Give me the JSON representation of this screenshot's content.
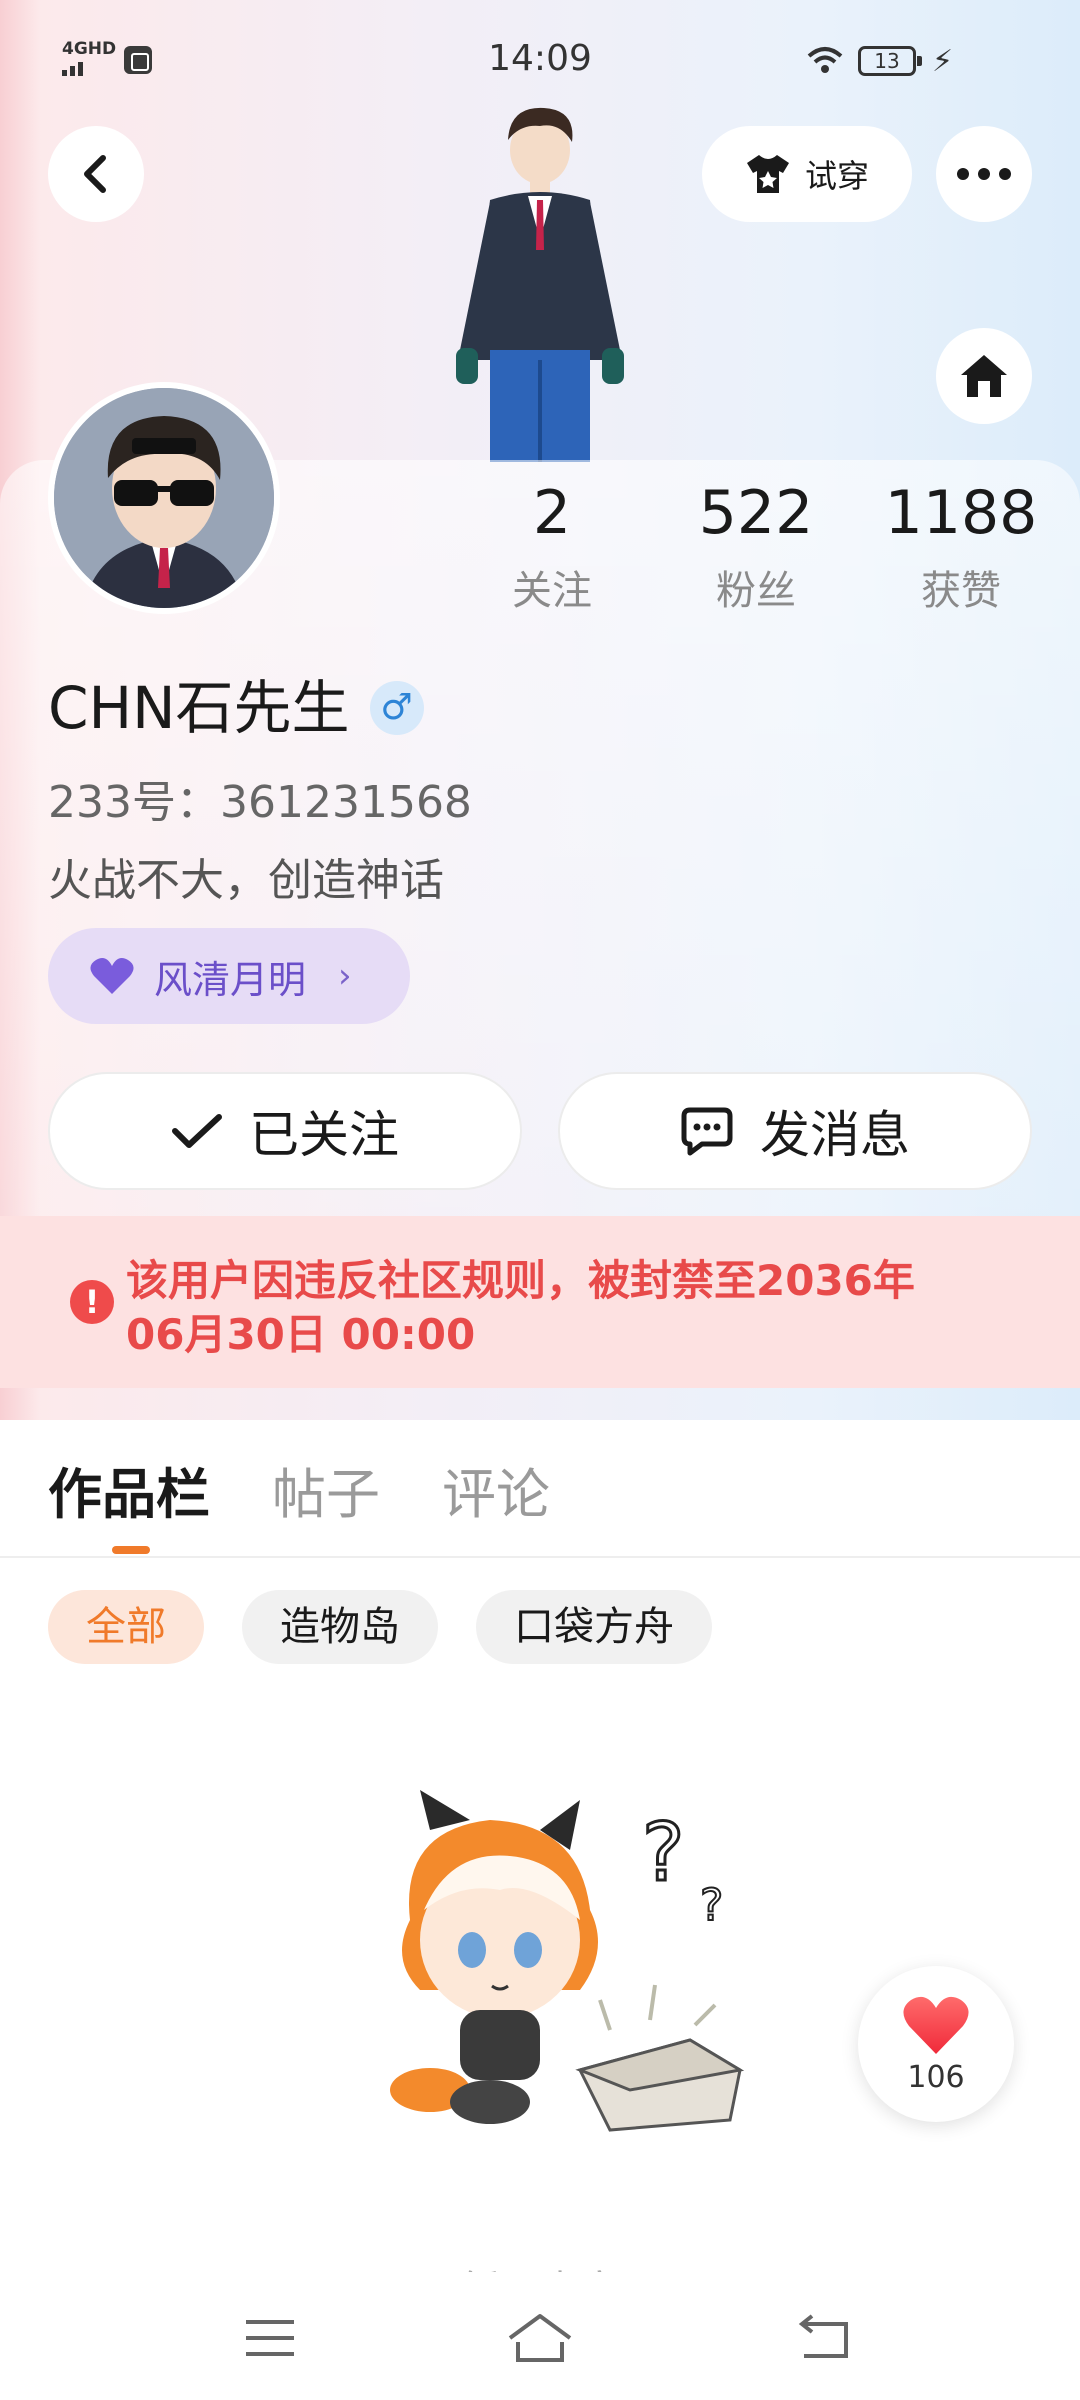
{
  "status_bar": {
    "network": "4GHD",
    "time": "14:09",
    "battery": "13"
  },
  "header": {
    "try_on_label": "试穿"
  },
  "stats": {
    "following_count": "2",
    "following_label": "关注",
    "fans_count": "522",
    "fans_label": "粉丝",
    "likes_count": "1188",
    "likes_label": "获赞"
  },
  "profile": {
    "username": "CHN石先生",
    "gender_symbol": "♂",
    "uid": "233号：361231568",
    "bio": "火战不大，创造神话",
    "tag_label": "风清月明"
  },
  "actions": {
    "follow_label": "已关注",
    "message_label": "发消息"
  },
  "ban_notice": {
    "line1": "该用户因违反社区规则，被封禁至2036年",
    "line2": "06月30日 00:00"
  },
  "tabs": [
    {
      "label": "作品栏"
    },
    {
      "label": "帖子"
    },
    {
      "label": "评论"
    }
  ],
  "chips": [
    {
      "label": "全部"
    },
    {
      "label": "造物岛"
    },
    {
      "label": "口袋方舟"
    }
  ],
  "like_float": {
    "count": "106"
  },
  "colors": {
    "accent": "#f07a2a",
    "ban_text": "#e84a4a",
    "tag_purple": "#6b4fc9"
  }
}
